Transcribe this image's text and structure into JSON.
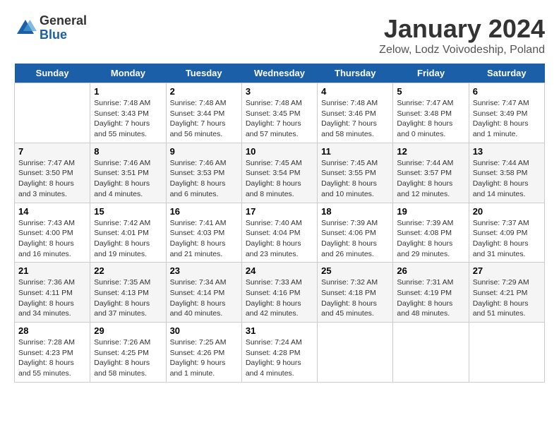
{
  "logo": {
    "general": "General",
    "blue": "Blue"
  },
  "title": "January 2024",
  "subtitle": "Zelow, Lodz Voivodeship, Poland",
  "headers": [
    "Sunday",
    "Monday",
    "Tuesday",
    "Wednesday",
    "Thursday",
    "Friday",
    "Saturday"
  ],
  "weeks": [
    [
      {
        "num": "",
        "info": ""
      },
      {
        "num": "1",
        "info": "Sunrise: 7:48 AM\nSunset: 3:43 PM\nDaylight: 7 hours\nand 55 minutes."
      },
      {
        "num": "2",
        "info": "Sunrise: 7:48 AM\nSunset: 3:44 PM\nDaylight: 7 hours\nand 56 minutes."
      },
      {
        "num": "3",
        "info": "Sunrise: 7:48 AM\nSunset: 3:45 PM\nDaylight: 7 hours\nand 57 minutes."
      },
      {
        "num": "4",
        "info": "Sunrise: 7:48 AM\nSunset: 3:46 PM\nDaylight: 7 hours\nand 58 minutes."
      },
      {
        "num": "5",
        "info": "Sunrise: 7:47 AM\nSunset: 3:48 PM\nDaylight: 8 hours\nand 0 minutes."
      },
      {
        "num": "6",
        "info": "Sunrise: 7:47 AM\nSunset: 3:49 PM\nDaylight: 8 hours\nand 1 minute."
      }
    ],
    [
      {
        "num": "7",
        "info": "Sunrise: 7:47 AM\nSunset: 3:50 PM\nDaylight: 8 hours\nand 3 minutes."
      },
      {
        "num": "8",
        "info": "Sunrise: 7:46 AM\nSunset: 3:51 PM\nDaylight: 8 hours\nand 4 minutes."
      },
      {
        "num": "9",
        "info": "Sunrise: 7:46 AM\nSunset: 3:53 PM\nDaylight: 8 hours\nand 6 minutes."
      },
      {
        "num": "10",
        "info": "Sunrise: 7:45 AM\nSunset: 3:54 PM\nDaylight: 8 hours\nand 8 minutes."
      },
      {
        "num": "11",
        "info": "Sunrise: 7:45 AM\nSunset: 3:55 PM\nDaylight: 8 hours\nand 10 minutes."
      },
      {
        "num": "12",
        "info": "Sunrise: 7:44 AM\nSunset: 3:57 PM\nDaylight: 8 hours\nand 12 minutes."
      },
      {
        "num": "13",
        "info": "Sunrise: 7:44 AM\nSunset: 3:58 PM\nDaylight: 8 hours\nand 14 minutes."
      }
    ],
    [
      {
        "num": "14",
        "info": "Sunrise: 7:43 AM\nSunset: 4:00 PM\nDaylight: 8 hours\nand 16 minutes."
      },
      {
        "num": "15",
        "info": "Sunrise: 7:42 AM\nSunset: 4:01 PM\nDaylight: 8 hours\nand 19 minutes."
      },
      {
        "num": "16",
        "info": "Sunrise: 7:41 AM\nSunset: 4:03 PM\nDaylight: 8 hours\nand 21 minutes."
      },
      {
        "num": "17",
        "info": "Sunrise: 7:40 AM\nSunset: 4:04 PM\nDaylight: 8 hours\nand 23 minutes."
      },
      {
        "num": "18",
        "info": "Sunrise: 7:39 AM\nSunset: 4:06 PM\nDaylight: 8 hours\nand 26 minutes."
      },
      {
        "num": "19",
        "info": "Sunrise: 7:39 AM\nSunset: 4:08 PM\nDaylight: 8 hours\nand 29 minutes."
      },
      {
        "num": "20",
        "info": "Sunrise: 7:37 AM\nSunset: 4:09 PM\nDaylight: 8 hours\nand 31 minutes."
      }
    ],
    [
      {
        "num": "21",
        "info": "Sunrise: 7:36 AM\nSunset: 4:11 PM\nDaylight: 8 hours\nand 34 minutes."
      },
      {
        "num": "22",
        "info": "Sunrise: 7:35 AM\nSunset: 4:13 PM\nDaylight: 8 hours\nand 37 minutes."
      },
      {
        "num": "23",
        "info": "Sunrise: 7:34 AM\nSunset: 4:14 PM\nDaylight: 8 hours\nand 40 minutes."
      },
      {
        "num": "24",
        "info": "Sunrise: 7:33 AM\nSunset: 4:16 PM\nDaylight: 8 hours\nand 42 minutes."
      },
      {
        "num": "25",
        "info": "Sunrise: 7:32 AM\nSunset: 4:18 PM\nDaylight: 8 hours\nand 45 minutes."
      },
      {
        "num": "26",
        "info": "Sunrise: 7:31 AM\nSunset: 4:19 PM\nDaylight: 8 hours\nand 48 minutes."
      },
      {
        "num": "27",
        "info": "Sunrise: 7:29 AM\nSunset: 4:21 PM\nDaylight: 8 hours\nand 51 minutes."
      }
    ],
    [
      {
        "num": "28",
        "info": "Sunrise: 7:28 AM\nSunset: 4:23 PM\nDaylight: 8 hours\nand 55 minutes."
      },
      {
        "num": "29",
        "info": "Sunrise: 7:26 AM\nSunset: 4:25 PM\nDaylight: 8 hours\nand 58 minutes."
      },
      {
        "num": "30",
        "info": "Sunrise: 7:25 AM\nSunset: 4:26 PM\nDaylight: 9 hours\nand 1 minute."
      },
      {
        "num": "31",
        "info": "Sunrise: 7:24 AM\nSunset: 4:28 PM\nDaylight: 9 hours\nand 4 minutes."
      },
      {
        "num": "",
        "info": ""
      },
      {
        "num": "",
        "info": ""
      },
      {
        "num": "",
        "info": ""
      }
    ]
  ]
}
